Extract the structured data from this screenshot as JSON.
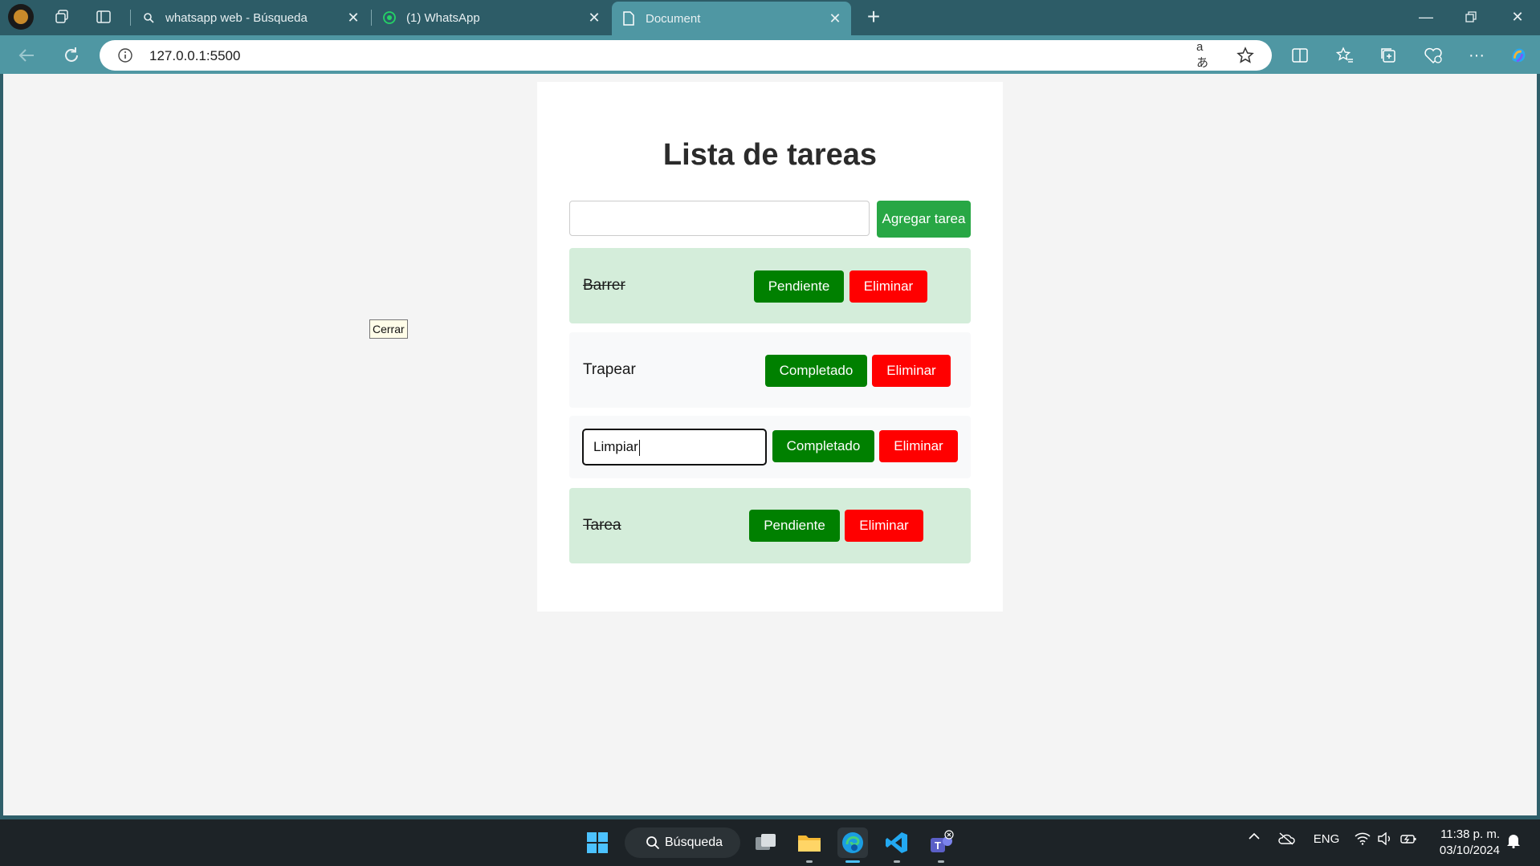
{
  "browser": {
    "tabs": [
      {
        "title": "whatsapp web - Búsqueda",
        "icon": "search-icon",
        "active": false
      },
      {
        "title": "(1) WhatsApp",
        "icon": "whatsapp-icon",
        "active": false
      },
      {
        "title": "Document",
        "icon": "document-icon",
        "active": true
      }
    ],
    "url": "127.0.0.1:5500",
    "accent": "#4f97a3"
  },
  "page": {
    "heading": "Lista de tareas",
    "new_task_value": "",
    "add_button": "Agregar tarea",
    "floating_button": "Cerrar",
    "tasks": [
      {
        "text": "Barrer",
        "state": "completed",
        "toggle_label": "Pendiente",
        "delete_label": "Eliminar"
      },
      {
        "text": "Trapear",
        "state": "pending",
        "toggle_label": "Completado",
        "delete_label": "Eliminar"
      },
      {
        "text": "Limpiar",
        "state": "editing",
        "toggle_label": "Completado",
        "delete_label": "Eliminar"
      },
      {
        "text": "Tarea",
        "state": "completed",
        "toggle_label": "Pendiente",
        "delete_label": "Eliminar"
      }
    ],
    "colors": {
      "add": "#28a745",
      "toggle": "#008000",
      "delete": "#ff0000",
      "done_bg": "#d4edda"
    }
  },
  "taskbar": {
    "search_label": "Búsqueda",
    "language": "ENG",
    "time": "11:38 p. m.",
    "date": "03/10/2024"
  }
}
